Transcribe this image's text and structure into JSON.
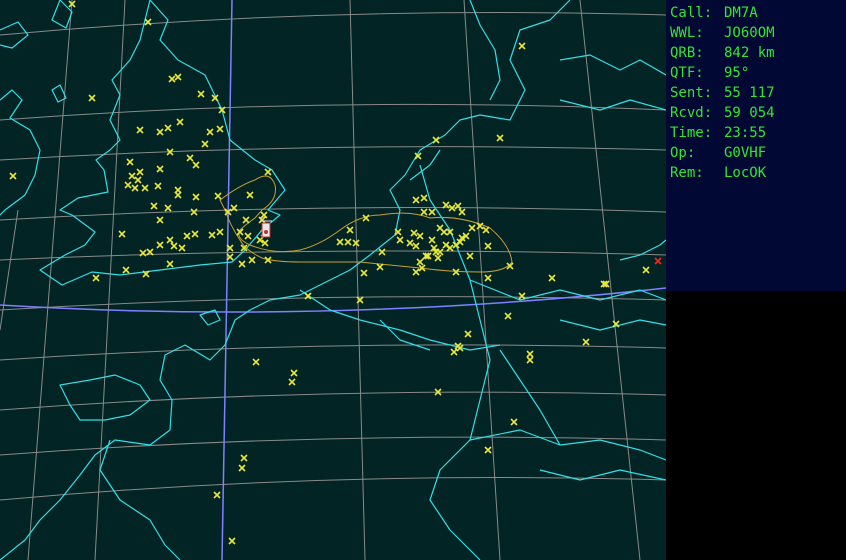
{
  "info": {
    "call": {
      "label": "Call:",
      "value": "DM7A"
    },
    "wwl": {
      "label": "WWL:",
      "value": "JO60OM"
    },
    "qrb": {
      "label": "QRB:",
      "value": "842 km"
    },
    "qtf": {
      "label": "QTF:",
      "value": "95°"
    },
    "sent": {
      "label": "Sent:",
      "value": "55 117"
    },
    "rcvd": {
      "label": "Rcvd:",
      "value": "59 054"
    },
    "time": {
      "label": "Time:",
      "value": "23:55"
    },
    "op": {
      "label": "Op:",
      "value": "G0VHF"
    },
    "rem": {
      "label": "Rem:",
      "value": "LocOK"
    }
  },
  "colors": {
    "map_background": "#022424",
    "coastline": "#30e0e8",
    "grid": "#8a8a8a",
    "boundary": "#8080ff",
    "contact_marker": "#e8e83a",
    "current_contact": "#ff2020",
    "coverage_outline": "#c8a030",
    "info_background": "#000833",
    "info_text": "#32e632"
  },
  "marker_icon": "x-cross-icon",
  "home_icon": "home-station-icon"
}
